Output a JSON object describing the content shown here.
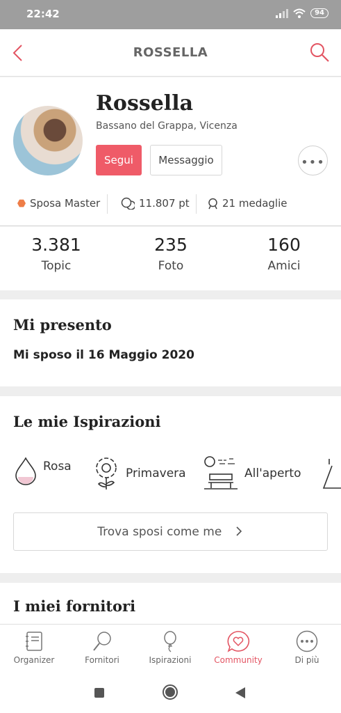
{
  "status_bar": {
    "time": "22:42",
    "battery": "94"
  },
  "header": {
    "title": "ROSSELLA"
  },
  "profile": {
    "name": "Rossella",
    "location": "Bassano del Grappa, Vicenza",
    "follow_label": "Segui",
    "message_label": "Messaggio",
    "more_label": "•••",
    "level": "Sposa Master",
    "points": "11.807 pt",
    "medals": "21 medaglie"
  },
  "stats": [
    {
      "value": "3.381",
      "label": "Topic"
    },
    {
      "value": "235",
      "label": "Foto"
    },
    {
      "value": "160",
      "label": "Amici"
    }
  ],
  "intro": {
    "title": "Mi presento",
    "text": "Mi sposo il 16 Maggio 2020"
  },
  "inspirations": {
    "title": "Le mie Ispirazioni",
    "items": [
      "Rosa",
      "Primavera",
      "All'aperto"
    ],
    "find_button": "Trova sposi come me"
  },
  "vendors": {
    "title": "I miei fornitori"
  },
  "bottom_nav": {
    "items": [
      "Organizer",
      "Fornitori",
      "Ispirazioni",
      "Community",
      "Di più"
    ],
    "active": "Community"
  },
  "colors": {
    "accent": "#ef5b68",
    "level_badge": "#ee7d47"
  }
}
